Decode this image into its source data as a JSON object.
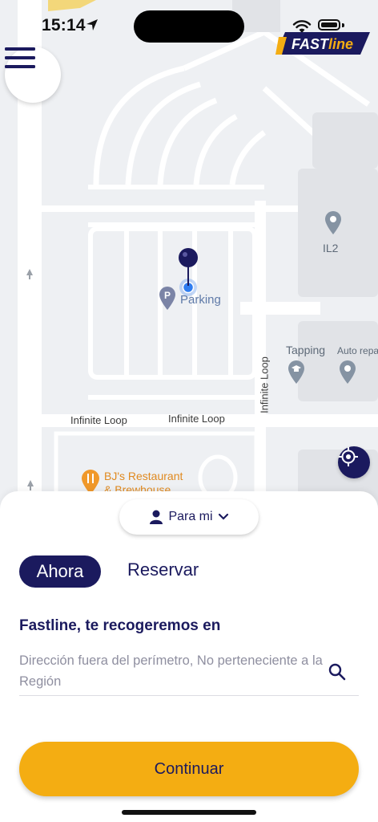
{
  "status_bar": {
    "time": "15:14"
  },
  "brand": {
    "logo_part1": "FAST",
    "logo_part2": "line",
    "navy": "#1b1a5e",
    "yellow": "#f4ad12"
  },
  "map": {
    "labels": {
      "parking": "Parking",
      "il2": "IL2",
      "tapping": "Tapping",
      "auto_repair": "Auto repa",
      "street_1": "Infinite Loop",
      "street_2": "Infinite Loop",
      "street_vertical": "Infinite Loop",
      "restaurant_line1": "BJ's Restaurant",
      "restaurant_line2": "& Brewhouse"
    },
    "icons": [
      "menu-icon",
      "locate-icon",
      "pin-icon",
      "parking-icon",
      "poi-icon",
      "restaurant-icon"
    ]
  },
  "sheet": {
    "rider_selector": "Para mi",
    "tabs": [
      {
        "label": "Ahora",
        "active": true
      },
      {
        "label": "Reservar",
        "active": false
      }
    ],
    "pickup_heading": "Fastline, te recogeremos en",
    "pickup_address": "Dirección fuera del perímetro, No perteneciente a la Región",
    "continue_label": "Continuar"
  }
}
